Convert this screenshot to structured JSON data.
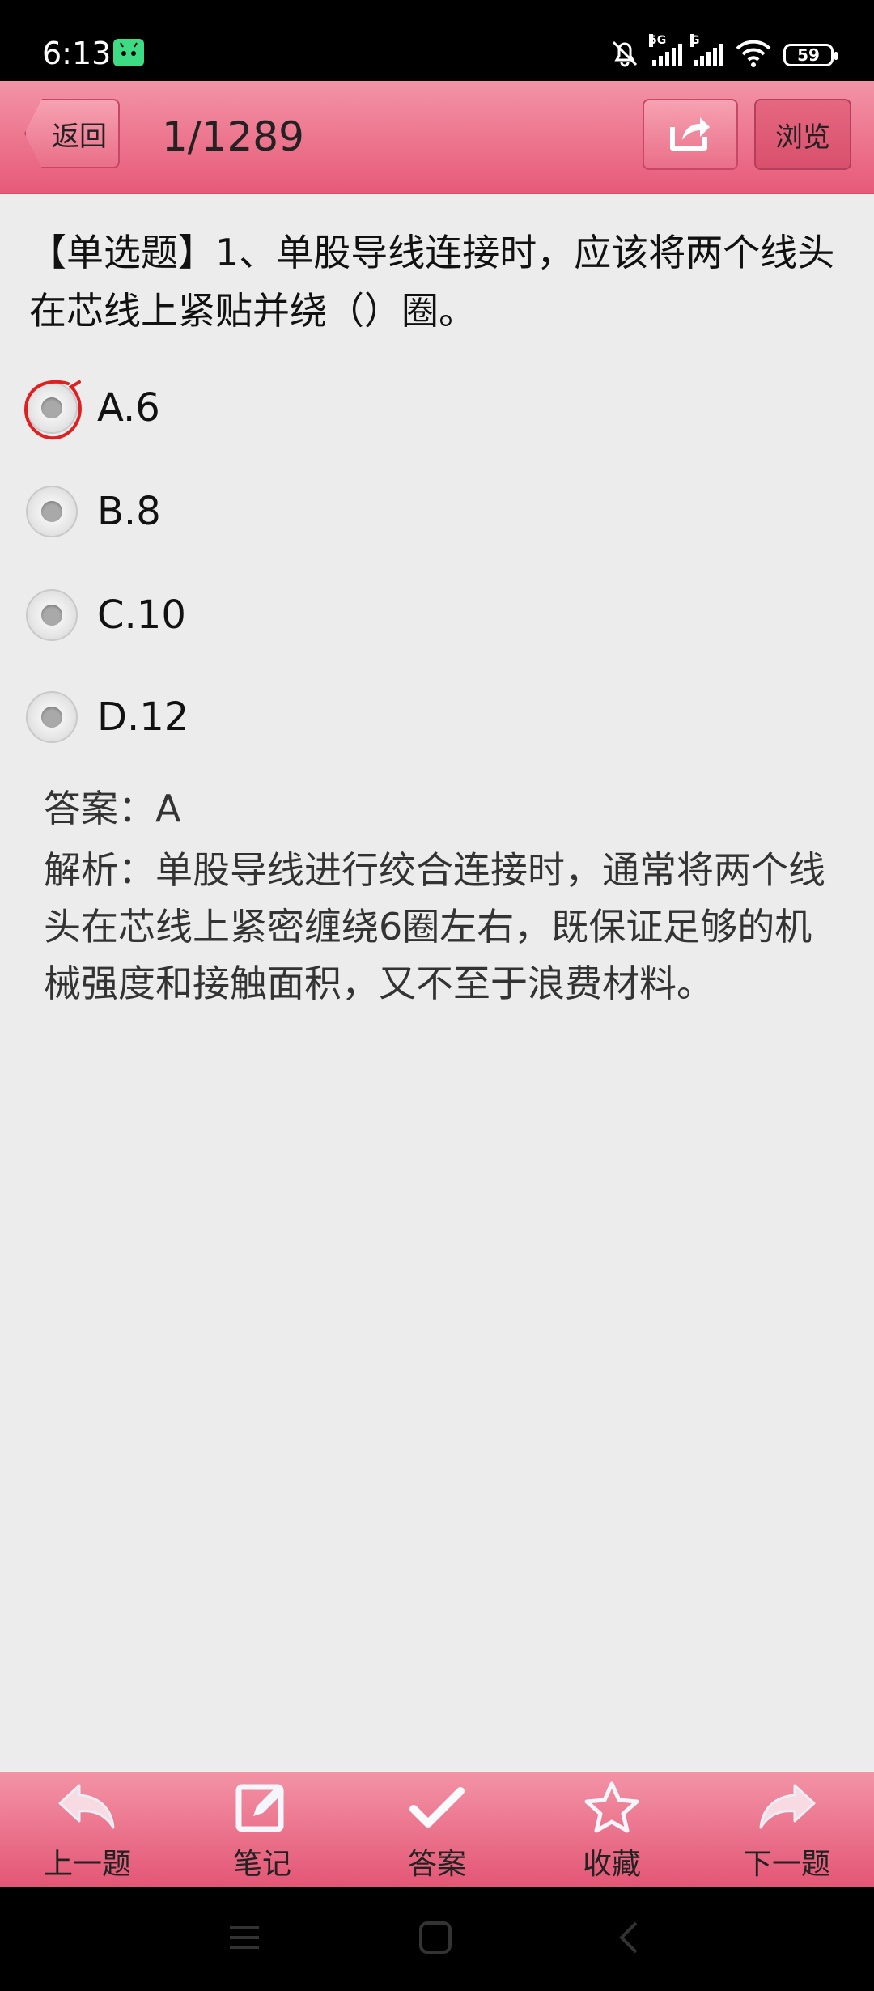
{
  "status_bar": {
    "time": "6:13",
    "network1": "5G",
    "network2": "G",
    "battery": "59",
    "icons": [
      "android-icon",
      "mute-icon",
      "signal-icon",
      "signal-icon",
      "wifi-icon",
      "battery-icon"
    ]
  },
  "header": {
    "back_label": "返回",
    "title": "1/1289",
    "share_icon": "share-icon",
    "browse_label": "浏览"
  },
  "question": {
    "text": "【单选题】1、单股导线连接时，应该将两个线头在芯线上紧贴并绕（）圈。",
    "options": [
      {
        "label": "A.6",
        "selected": true
      },
      {
        "label": "B.8",
        "selected": false
      },
      {
        "label": "C.10",
        "selected": false
      },
      {
        "label": "D.12",
        "selected": false
      }
    ],
    "answer": "答案：A",
    "analysis": "解析：单股导线进行绞合连接时，通常将两个线头在芯线上紧密缠绕6圈左右，既保证足够的机械强度和接触面积，又不至于浪费材料。"
  },
  "toolbar": {
    "items": [
      {
        "label": "上一题",
        "icon": "prev-arrow-icon"
      },
      {
        "label": "笔记",
        "icon": "note-edit-icon"
      },
      {
        "label": "答案",
        "icon": "check-icon"
      },
      {
        "label": "收藏",
        "icon": "star-icon"
      },
      {
        "label": "下一题",
        "icon": "next-arrow-icon"
      }
    ]
  },
  "colors": {
    "header_pink": "#e75a79",
    "highlight_red": "#e02020"
  }
}
